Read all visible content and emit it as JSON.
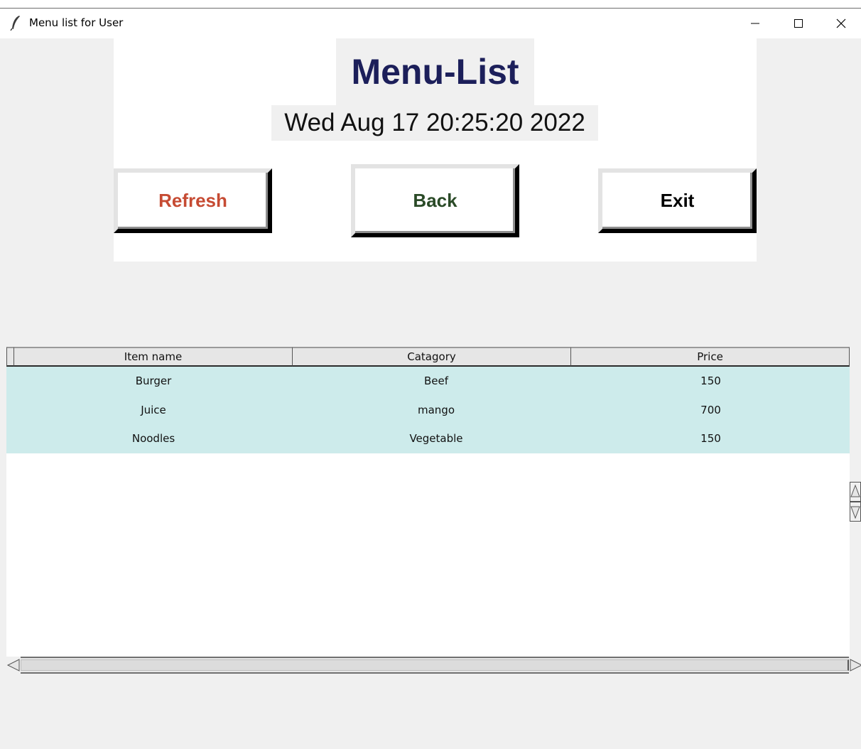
{
  "window": {
    "title": "Menu list for User",
    "icon": "feather-icon",
    "controls": [
      "minimize-icon",
      "maximize-icon",
      "close-icon"
    ]
  },
  "header": {
    "title": "Menu-List",
    "datetime": "Wed Aug 17 20:25:20 2022"
  },
  "buttons": {
    "refresh": {
      "label": "Refresh",
      "color": "#c64b33"
    },
    "back": {
      "label": "Back",
      "color": "#2a4a27"
    },
    "exit": {
      "label": "Exit",
      "color": "#000000"
    }
  },
  "table": {
    "columns": [
      "Item name",
      "Catagory",
      "Price"
    ],
    "rows": [
      [
        "Burger",
        "Beef",
        "150"
      ],
      [
        "Juice",
        "mango",
        "700"
      ],
      [
        "Noodles",
        "Vegetable",
        "150"
      ]
    ],
    "row_background": "#cdebeb"
  },
  "colors": {
    "title": "#1c1f5a",
    "background": "#f0f0f0",
    "panel": "#ffffff"
  }
}
